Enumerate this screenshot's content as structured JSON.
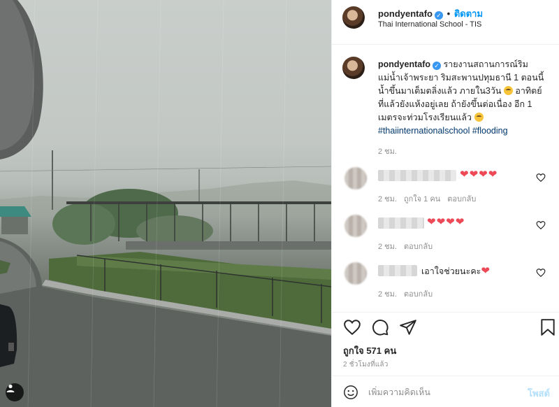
{
  "post": {
    "username": "pondyentafo",
    "verified_mark": "✓",
    "separator": "•",
    "follow_label": "ติดตาม",
    "location": "Thai International School - TIS",
    "caption_text": "รายงานสถานการณ์ริมแม่น้ำเจ้าพระยา ริมสะพานปทุมธานี 1 ตอนนี้น้ำขึ้นมาเต็มตลิ่งแล้ว ภายใน3วัน",
    "caption_text2": "อาทิตย์ที่แล้วยังแห้งอยู่เลย ถ้ายังขึ้นต่อเนื่อง อีก 1 เมตรจะท่วมโรงเรียนแล้ว",
    "hashtags": "#thaiinternationalschool #flooding",
    "caption_time": "2 ชม.",
    "likes_label": "ถูกใจ 571 คน",
    "post_time": "2 ชั่วโมงที่แล้ว"
  },
  "comments": [
    {
      "text": "❤❤❤❤",
      "time": "2 ชม.",
      "likes": "ถูกใจ 1 คน",
      "reply": "ตอบกลับ"
    },
    {
      "text": "❤❤❤❤",
      "time": "2 ชม.",
      "reply": "ตอบกลับ"
    },
    {
      "text": "เอาใจช่วยนะคะ",
      "heart": "❤",
      "time": "2 ชม.",
      "reply": "ตอบกลับ"
    }
  ],
  "comment_box": {
    "placeholder": "เพิ่มความคิดเห็น",
    "post_label": "โพสต์"
  },
  "colors": {
    "link": "#0095f6",
    "hashtag": "#00376b",
    "heart": "#ed4956",
    "muted": "#8e8e8e"
  },
  "icons": [
    "heart-icon",
    "comment-icon",
    "share-icon",
    "bookmark-icon",
    "smile-icon",
    "user-tag-icon",
    "verified-icon"
  ]
}
